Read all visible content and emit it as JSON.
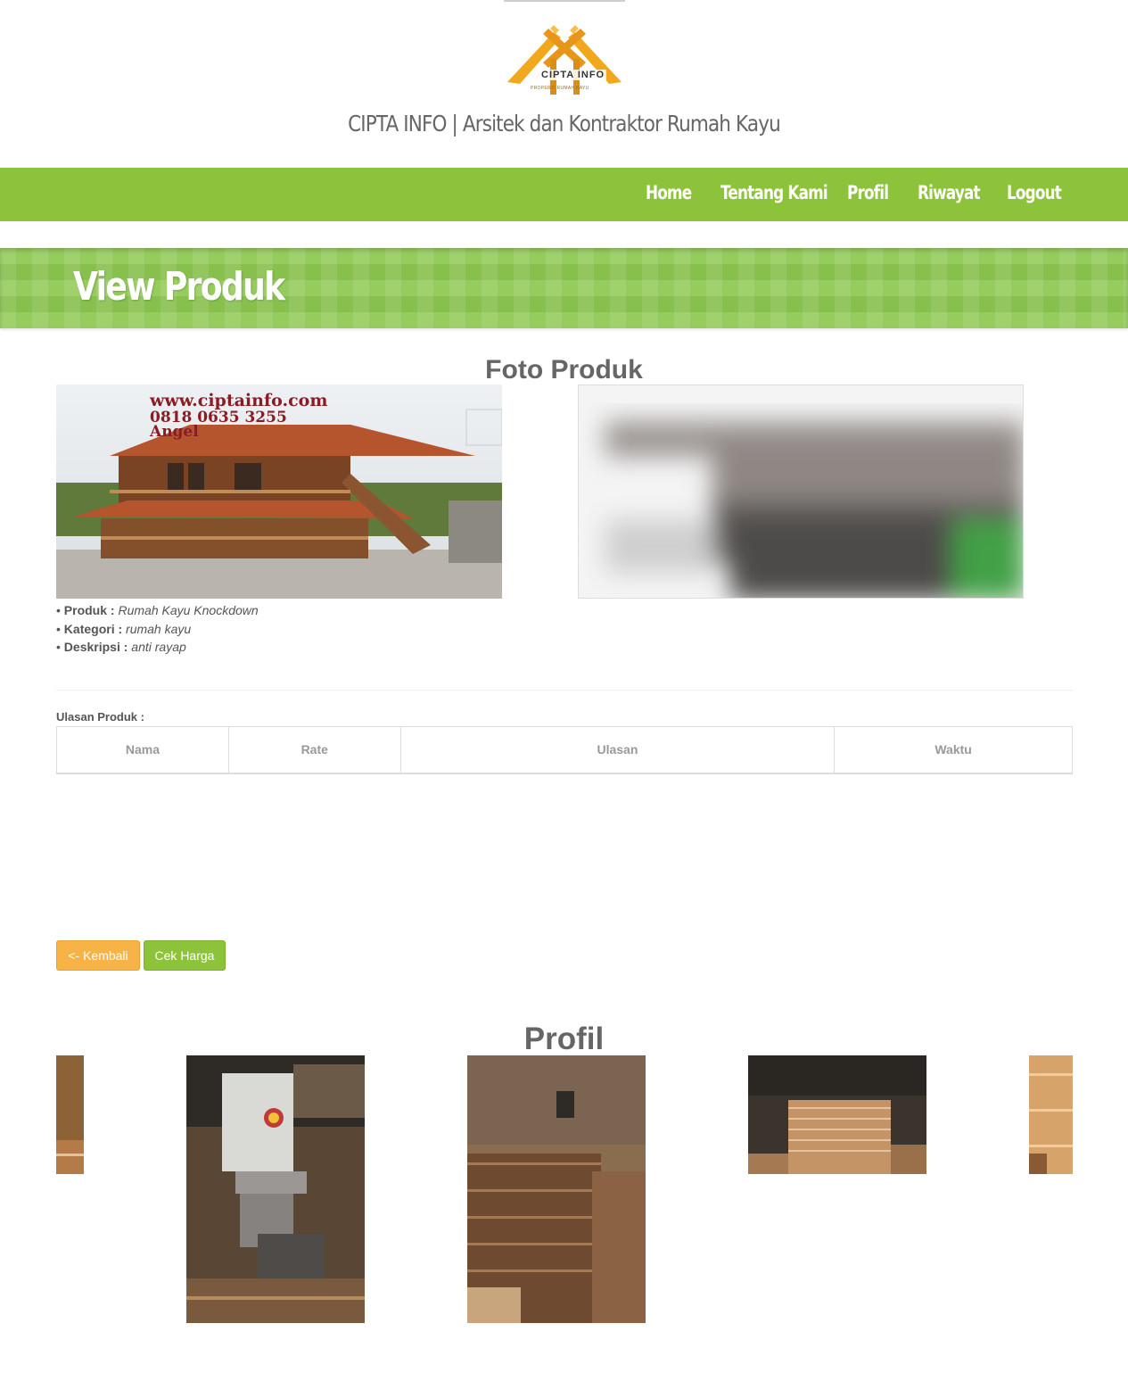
{
  "header": {
    "logo": {
      "main_text": "CIPTA INFO",
      "tagline": "PROPERTI RUMAH KAYU"
    },
    "site_title": "CIPTA INFO | Arsitek dan Kontraktor Rumah Kayu"
  },
  "nav": {
    "items": [
      {
        "label": "Home"
      },
      {
        "label": "Tentang Kami"
      },
      {
        "label": "Profil"
      },
      {
        "label": "Riwayat"
      },
      {
        "label": "Logout"
      }
    ],
    "color": "#8dc33a"
  },
  "banner": {
    "title": "View Produk"
  },
  "product": {
    "section_title": "Foto Produk",
    "photo_watermark": {
      "line1": "www.ciptainfo.com",
      "line2": "0818 0635 3255",
      "line3": "Angel"
    },
    "details": [
      {
        "label": "Produk :",
        "value": "Rumah Kayu Knockdown"
      },
      {
        "label": "Kategori :",
        "value": "rumah kayu"
      },
      {
        "label": "Deskripsi :",
        "value": "anti rayap"
      }
    ]
  },
  "reviews": {
    "label": "Ulasan Produk :",
    "columns": [
      "Nama",
      "Rate",
      "Ulasan",
      "Waktu"
    ],
    "rows": []
  },
  "buttons": {
    "back_label": "<- Kembali",
    "price_label": "Cek Harga",
    "back_color": "#f7b346",
    "price_color": "#8dc33a"
  },
  "profile": {
    "section_title": "Profil"
  }
}
